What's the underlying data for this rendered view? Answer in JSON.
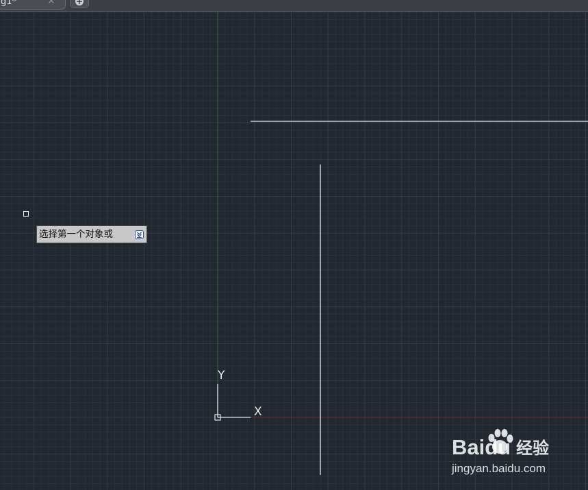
{
  "tabs": [
    {
      "label": "g1*"
    }
  ],
  "new_tab_symbol": "+",
  "tab_close_symbol": "×",
  "prompt": {
    "text": "选择第一个对象或"
  },
  "ucs": {
    "y_label": "Y",
    "x_label": "X"
  },
  "watermark": {
    "brand": "Baidu",
    "product": "经验",
    "url": "jingyan.baidu.com"
  },
  "colors": {
    "background": "#212830",
    "grid_minor": "#2b323c",
    "grid_major": "#343c47",
    "y_axis": "#2e6b3a",
    "x_axis": "#7a2a34",
    "geometry": "#e6e6e6"
  }
}
